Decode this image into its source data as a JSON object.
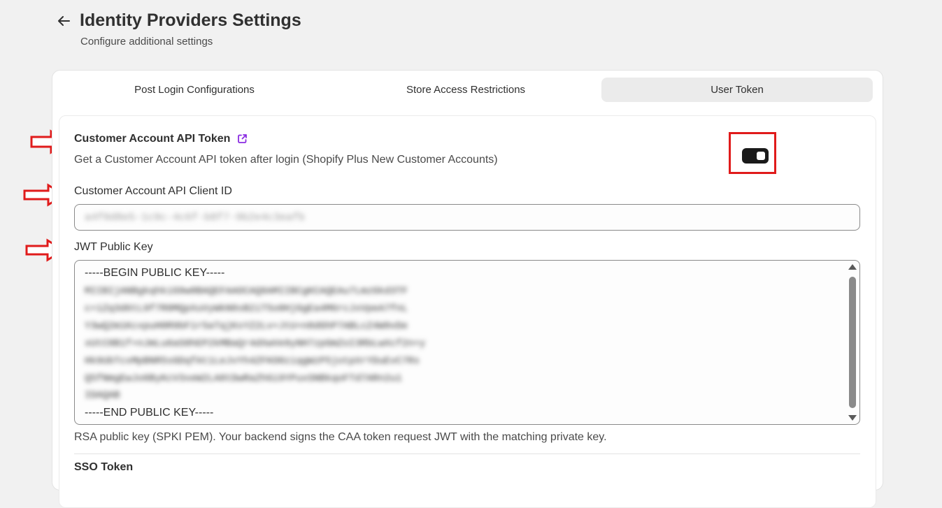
{
  "header": {
    "title": "Identity Providers Settings",
    "subtitle": "Configure additional settings",
    "back_icon": "arrow-left-icon"
  },
  "tabs": [
    {
      "label": "Post Login Configurations",
      "active": false
    },
    {
      "label": "Store Access Restrictions",
      "active": false
    },
    {
      "label": "User Token",
      "active": true
    }
  ],
  "customer_account_api_token": {
    "title": "Customer Account API Token",
    "description": "Get a Customer Account API token after login (Shopify Plus New Customer Accounts)",
    "enabled": true,
    "external_link_icon": "external-link-icon"
  },
  "client_id": {
    "label": "Customer Account API Client ID",
    "value": "a4f0d8e5-1c9c-4c6f-b8f7-9b2e4c3eafb"
  },
  "jwt_public_key": {
    "label": "JWT Public Key",
    "begin": "-----BEGIN PUBLIC KEY-----",
    "lines": [
      "MIIBIjANBgkqhkiG9w0BAQEFAAOCAQ8AMIIBCgKCAQEAu7LmzGkd3TF",
      "c+1Zq3d6tL9f7R0MQpXuVyWkN8sB2iT5o0HjGgEa4M6rcJxVpeA7fnL",
      "Y3wQ2m1KcxpuH0R9bF1r5aTqjKsYZ2Lv+JtU+n8dGhP7ABLcZ4W9vDe",
      "xUtC8B1f+nJmLu6aS0hEP2kMBaQr4dXwVe9yNH7zpGmZoI3RbLwXcf2n+y",
      "Hk9UbTcxMpBNR5sGDqfAt1LeJvYh4ZFKO0ziqgWzP5jotpXrYDuEvC7Rs",
      "Q5fNmgEwJo6ByKcV3xeW2LA8tDwRaZhGi9YPuxSNBkqoFTd7ARn2u1",
      "IDAQAB"
    ],
    "end": "-----END PUBLIC KEY-----",
    "help": "RSA public key (SPKI PEM). Your backend signs the CAA token request JWT with the matching private key."
  },
  "next_section": {
    "title": "SSO Token"
  },
  "colors": {
    "accent_red": "#e01b1b",
    "toggle_on": "#1a1a1a",
    "link_purple": "#8a2be2"
  }
}
